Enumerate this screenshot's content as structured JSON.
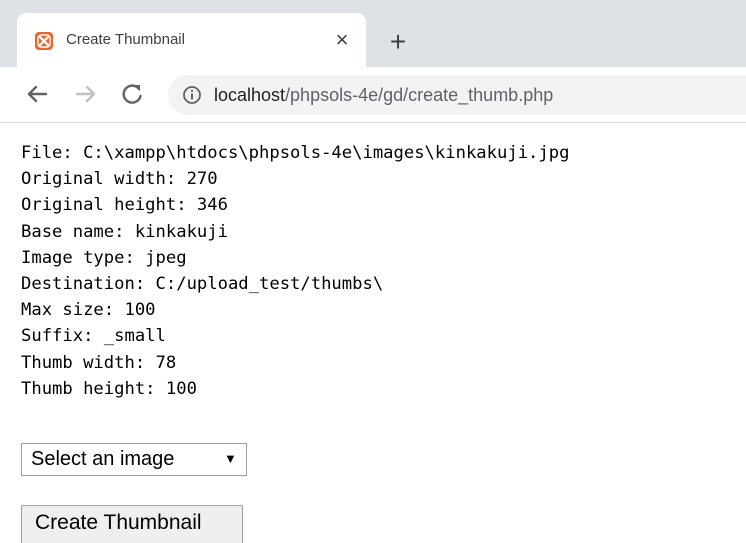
{
  "browser": {
    "tab": {
      "title": "Create Thumbnail",
      "favicon": "xampp-icon",
      "close_glyph": "×"
    },
    "new_tab_glyph": "+",
    "toolbar": {
      "back": "back-arrow-icon",
      "forward": "forward-arrow-icon",
      "reload": "reload-icon"
    },
    "address": {
      "host": "localhost",
      "path": "/phpsols-4e/gd/create_thumb.php"
    }
  },
  "main": {
    "lines": [
      "File: C:\\xampp\\htdocs\\phpsols-4e\\images\\kinkakuji.jpg",
      "Original width: 270",
      "Original height: 346",
      "Base name: kinkakuji",
      "Image type: jpeg",
      "Destination: C:/upload_test/thumbs\\",
      "Max size: 100",
      "Suffix: _small",
      "Thumb width: 78",
      "Thumb height: 100"
    ],
    "select": {
      "selected": "Select an image",
      "arrow": "▼"
    },
    "submit_label": "Create Thumbnail"
  },
  "colors": {
    "tabstrip": "#dee1e6",
    "omnibox": "#f1f3f4",
    "favicon": "#e8682a"
  }
}
